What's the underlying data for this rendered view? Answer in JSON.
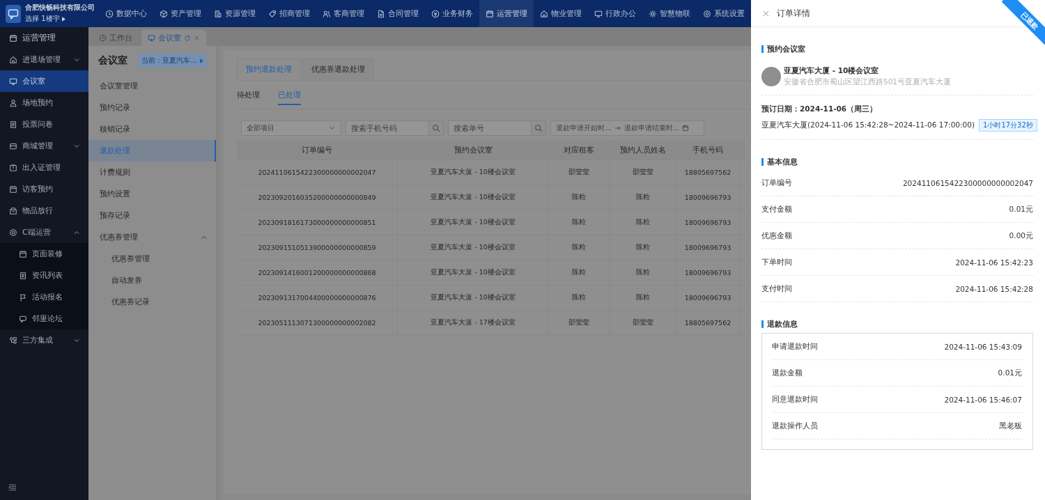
{
  "header": {
    "company": "合肥快畅科技有限公司",
    "building": "选择 1楼宇",
    "nav": [
      {
        "label": "数据中心",
        "selected": false
      },
      {
        "label": "资产管理",
        "selected": false
      },
      {
        "label": "资源管理",
        "selected": false
      },
      {
        "label": "招商管理",
        "selected": false
      },
      {
        "label": "客商管理",
        "selected": false
      },
      {
        "label": "合同管理",
        "selected": false
      },
      {
        "label": "业务财务",
        "selected": false
      },
      {
        "label": "运营管理",
        "selected": true
      },
      {
        "label": "物业管理",
        "selected": false
      },
      {
        "label": "行政办公",
        "selected": false
      },
      {
        "label": "智慧物联",
        "selected": false
      },
      {
        "label": "系统设置",
        "selected": false
      }
    ]
  },
  "sidebar": {
    "title": "运营管理",
    "items": [
      {
        "label": "进退场管理",
        "selected": false,
        "expanded": false
      },
      {
        "label": "会议室",
        "selected": true
      },
      {
        "label": "场地预约",
        "selected": false
      },
      {
        "label": "投票问卷",
        "selected": false
      },
      {
        "label": "商城管理",
        "selected": false,
        "expanded": false
      },
      {
        "label": "出入证管理",
        "selected": false
      },
      {
        "label": "访客预约",
        "selected": false
      },
      {
        "label": "物品放行",
        "selected": false
      },
      {
        "label": "C端运营",
        "selected": false,
        "expanded": true,
        "children": [
          {
            "label": "页面装修",
            "selected": false
          },
          {
            "label": "资讯列表",
            "selected": false
          },
          {
            "label": "活动报名",
            "selected": false
          },
          {
            "label": "邻里论坛",
            "selected": false
          }
        ]
      },
      {
        "label": "三方集成",
        "selected": false,
        "expanded": false
      }
    ]
  },
  "page_tabs": [
    {
      "label": "工作台",
      "selected": false
    },
    {
      "label": "会议室",
      "selected": true
    }
  ],
  "submenu": {
    "title": "会议室",
    "current": "当前：亚夏汽车...",
    "items": [
      {
        "label": "会议室管理",
        "selected": false
      },
      {
        "label": "预约记录",
        "selected": false
      },
      {
        "label": "核销记录",
        "selected": false
      },
      {
        "label": "退款处理",
        "selected": true
      },
      {
        "label": "计费规则",
        "selected": false
      },
      {
        "label": "预约设置",
        "selected": false
      },
      {
        "label": "预存记录",
        "selected": false
      },
      {
        "label": "优惠券管理",
        "selected": false,
        "expanded": true,
        "children": [
          {
            "label": "优惠券管理",
            "selected": false
          },
          {
            "label": "自动发券",
            "selected": false
          },
          {
            "label": "优惠券记录",
            "selected": false
          }
        ]
      }
    ]
  },
  "content": {
    "tabs": [
      {
        "label": "预约退款处理",
        "selected": true
      },
      {
        "label": "优惠券退款处理",
        "selected": false
      }
    ],
    "status_tabs": [
      {
        "label": "待处理",
        "selected": false
      },
      {
        "label": "已处理",
        "selected": true
      }
    ],
    "filters": {
      "project": {
        "placeholder": "全部项目"
      },
      "phone": {
        "placeholder": "搜索手机号码"
      },
      "order": {
        "placeholder": "搜索单号"
      },
      "start": {
        "placeholder": "退款申请开始时..."
      },
      "end": {
        "placeholder": "退款申请结束时..."
      }
    },
    "table": {
      "columns": [
        "订单编号",
        "预约会议室",
        "对应租客",
        "预约人员姓名",
        "手机号码"
      ],
      "rows": [
        [
          "2024110615422300000000002047",
          "亚夏汽车大厦 - 10楼会议室",
          "邵莹莹",
          "邵莹莹",
          "18805697562"
        ],
        [
          "2023092016035200000000000849",
          "亚夏汽车大厦 - 10楼会议室",
          "陈粒",
          "陈粒",
          "18009696793"
        ],
        [
          "2023091816173000000000000851",
          "亚夏汽车大厦 - 10楼会议室",
          "陈粒",
          "陈粒",
          "18009696793"
        ],
        [
          "2023091510513900000000000859",
          "亚夏汽车大厦 - 10楼会议室",
          "陈粒",
          "陈粒",
          "18009696793"
        ],
        [
          "2023091416001200000000000868",
          "亚夏汽车大厦 - 10楼会议室",
          "陈粒",
          "陈粒",
          "18009696793"
        ],
        [
          "2023091317004400000000000876",
          "亚夏汽车大厦 - 10楼会议室",
          "陈粒",
          "陈粒",
          "18009696793"
        ],
        [
          "2023051113071300000000002082",
          "亚夏汽车大厦 - 17楼会议室",
          "邵莹莹",
          "邵莹莹",
          "18805697562"
        ]
      ]
    }
  },
  "drawer": {
    "title": "订单详情",
    "status_ribbon": "已退款",
    "room_section": {
      "title": "预约会议室",
      "room_name": "亚夏汽车大厦 - 10楼会议室",
      "address": "安徽省合肥市蜀山区望江西路501号亚夏汽车大厦",
      "date_label": "预订日期：",
      "date": "2024-11-06（周三）",
      "period": "亚夏汽车大厦(2024-11-06 15:42:28~2024-11-06 17:00:00)",
      "duration": "1小时17分32秒"
    },
    "basic_section": {
      "title": "基本信息",
      "rows": [
        {
          "label": "订单编号",
          "value": "2024110615422300000000002047"
        },
        {
          "label": "支付金额",
          "value": "0.01元"
        },
        {
          "label": "优惠金额",
          "value": "0.00元"
        },
        {
          "label": "下单时间",
          "value": "2024-11-06 15:42:23"
        },
        {
          "label": "支付时间",
          "value": "2024-11-06 15:42:28"
        }
      ]
    },
    "refund_section": {
      "title": "退款信息",
      "rows": [
        {
          "label": "申请退款时间",
          "value": "2024-11-06 15:43:09"
        },
        {
          "label": "退款金额",
          "value": "0.01元"
        },
        {
          "label": "同意退款时间",
          "value": "2024-11-06 15:46:07"
        },
        {
          "label": "退款操作人员",
          "value": "黑老板"
        }
      ]
    }
  }
}
